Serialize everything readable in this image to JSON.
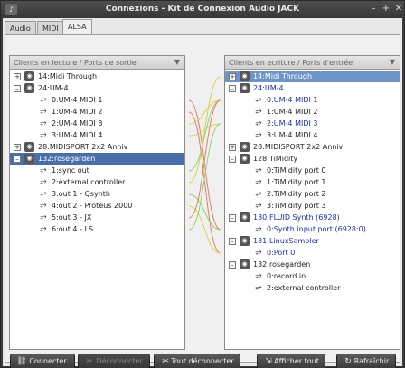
{
  "window": {
    "title": "Connexions - Kit de Connexion Audio JACK",
    "app_icon": "qjackctl-icon",
    "min_icon": "–",
    "max_icon": "+",
    "close_icon": "✕"
  },
  "tabs": [
    {
      "label": "Audio"
    },
    {
      "label": "MIDI"
    },
    {
      "label": "ALSA"
    }
  ],
  "left_panel": {
    "header": "Clients en lecture / Ports de sortie",
    "items": [
      {
        "type": "client",
        "expander": "+",
        "label": "14:Midi Through"
      },
      {
        "type": "client",
        "expander": "–",
        "label": "24:UM-4"
      },
      {
        "type": "port",
        "label": "0:UM-4 MIDI 1"
      },
      {
        "type": "port",
        "label": "1:UM-4 MIDI 2"
      },
      {
        "type": "port",
        "label": "2:UM-4 MIDI 3"
      },
      {
        "type": "port",
        "label": "3:UM-4 MIDI 4"
      },
      {
        "type": "client",
        "expander": "+",
        "label": "28:MIDISPORT 2x2 Anniv"
      },
      {
        "type": "client",
        "expander": "–",
        "label": "132:rosegarden",
        "selected": true
      },
      {
        "type": "port",
        "label": "1:sync out"
      },
      {
        "type": "port",
        "label": "2:external controller"
      },
      {
        "type": "port",
        "label": "3:out 1 - Qsynth"
      },
      {
        "type": "port",
        "label": "4:out 2 - Proteus 2000"
      },
      {
        "type": "port",
        "label": "5:out 3 - JX"
      },
      {
        "type": "port",
        "label": "6:out 4 - LS"
      }
    ]
  },
  "right_panel": {
    "header": "Clients en ecriture / Ports d'entrée",
    "items": [
      {
        "type": "client",
        "expander": "+",
        "label": "14:Midi Through",
        "selected": true
      },
      {
        "type": "client",
        "expander": "–",
        "label": "24:UM-4",
        "blue": true
      },
      {
        "type": "port",
        "label": "0:UM-4 MIDI 1",
        "blue": true
      },
      {
        "type": "port",
        "label": "1:UM-4 MIDI 2"
      },
      {
        "type": "port",
        "label": "2:UM-4 MIDI 3",
        "blue": true
      },
      {
        "type": "port",
        "label": "3:UM-4 MIDI 4"
      },
      {
        "type": "client",
        "expander": "+",
        "label": "28:MIDISPORT 2x2 Anniv"
      },
      {
        "type": "client",
        "expander": "–",
        "label": "128:TiMidity"
      },
      {
        "type": "port",
        "label": "0:TiMidity port 0"
      },
      {
        "type": "port",
        "label": "1:TiMidity port 1"
      },
      {
        "type": "port",
        "label": "2:TiMidity port 2"
      },
      {
        "type": "port",
        "label": "3:TiMidity port 3"
      },
      {
        "type": "client",
        "expander": "–",
        "label": "130:FLUID Synth (6928)",
        "blue": true
      },
      {
        "type": "port",
        "label": "0:Synth input port (6928:0)",
        "blue": true
      },
      {
        "type": "client",
        "expander": "–",
        "label": "131:LinuxSampler",
        "blue": true
      },
      {
        "type": "port",
        "label": "0:Port 0",
        "blue": true
      },
      {
        "type": "client",
        "expander": "–",
        "label": "132:rosegarden"
      },
      {
        "type": "port",
        "label": "0:record in"
      },
      {
        "type": "port",
        "label": "2:external controller"
      }
    ]
  },
  "buttons": [
    {
      "id": "connect",
      "label": "Connecter",
      "icon": "connect-icon",
      "glyph": "⛓",
      "enabled": true
    },
    {
      "id": "disconnect",
      "label": "Déconnecter",
      "icon": "disconnect-icon",
      "glyph": "✂",
      "enabled": false
    },
    {
      "id": "disconnect-all",
      "label": "Tout déconnecter",
      "icon": "disconnect-all-icon",
      "glyph": "✂",
      "enabled": true
    },
    {
      "id": "expand-all",
      "label": "Afficher tout",
      "icon": "expand-all-icon",
      "glyph": "⇲",
      "enabled": true
    },
    {
      "id": "refresh",
      "label": "Rafraîchir",
      "icon": "refresh-icon",
      "glyph": "↻",
      "enabled": true
    }
  ],
  "colors": {
    "selection": "#4a6fa8",
    "selection_light": "#6f95c8",
    "connected_text": "#1a2fb0",
    "line_red": "#e87a6a",
    "line_yellow": "#d6d24a",
    "line_green": "#8ed66a"
  }
}
